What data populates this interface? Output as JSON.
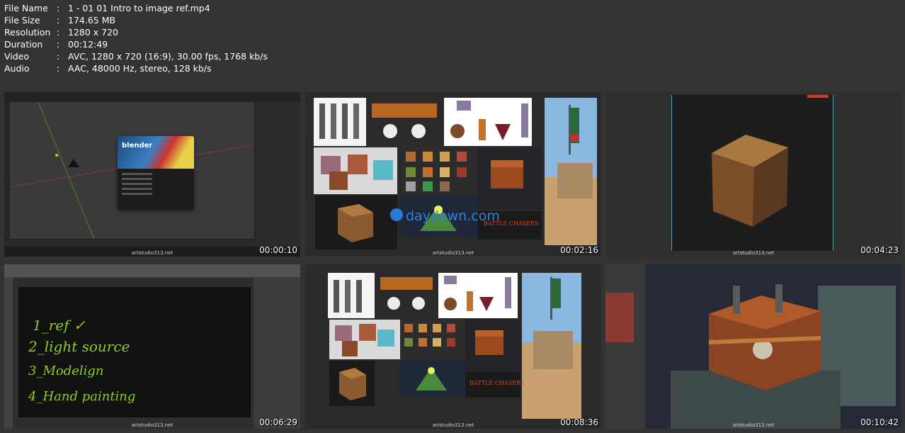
{
  "info": [
    {
      "key": "File Name",
      "value": "1 - 01 01 Intro to image ref.mp4"
    },
    {
      "key": "File Size",
      "value": "174.65 MB"
    },
    {
      "key": "Resolution",
      "value": "1280 x 720"
    },
    {
      "key": "Duration",
      "value": "00:12:49"
    },
    {
      "key": "Video",
      "value": "AVC, 1280 x 720 (16:9), 30.00 fps, 1768 kb/s"
    },
    {
      "key": "Audio",
      "value": "AAC, 48000 Hz, stereo, 128 kb/s"
    }
  ],
  "separator": ":",
  "watermark": "artstudio313.net",
  "overlay_watermark": "daydown.com",
  "blender_logo": "blender",
  "handwriting": [
    "1_ref ✓",
    "2_light source",
    "3_Modelign",
    "4_Hand painting"
  ],
  "chest_caption": "BATTLE CHASERS",
  "frames": [
    {
      "timestamp": "00:00:10"
    },
    {
      "timestamp": "00:02:16"
    },
    {
      "timestamp": "00:04:23"
    },
    {
      "timestamp": "00:06:29"
    },
    {
      "timestamp": "00:08:36"
    },
    {
      "timestamp": "00:10:42"
    }
  ]
}
